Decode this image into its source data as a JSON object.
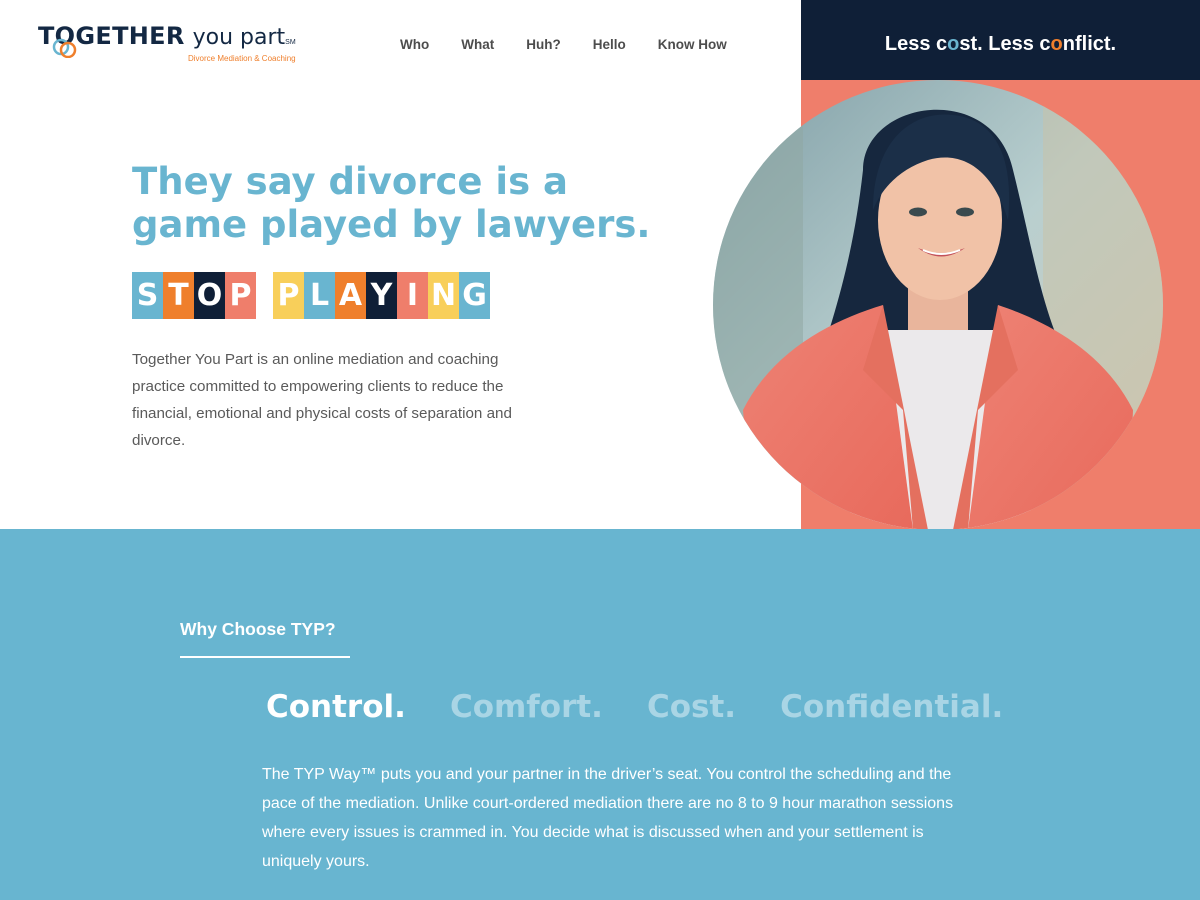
{
  "brand": {
    "name_strong": "TOGETHER",
    "name_light": "you part",
    "trademark": "SM",
    "tagline": "Divorce Mediation & Coaching",
    "colors": {
      "navy": "#132843",
      "orange": "#ef7f2c",
      "blue": "#69b5d0"
    }
  },
  "nav": {
    "items": [
      {
        "label": "Who"
      },
      {
        "label": "What"
      },
      {
        "label": "Huh?"
      },
      {
        "label": "Hello"
      },
      {
        "label": "Know How"
      }
    ]
  },
  "slogan": {
    "part1": "Less c",
    "o1": "o",
    "part2": "st. Less c",
    "o2": "o",
    "part3": "nflict."
  },
  "hero": {
    "headline": "They say divorce is a game played by lawyers.",
    "stop_playing": {
      "tiles": [
        {
          "letter": "S",
          "color": "#69b5d0"
        },
        {
          "letter": "T",
          "color": "#ef7f2c"
        },
        {
          "letter": "O",
          "color": "#0f1f37"
        },
        {
          "letter": "P",
          "color": "#ef7e6b"
        },
        {
          "letter": "",
          "color": "transparent"
        },
        {
          "letter": "P",
          "color": "#f8cf5a"
        },
        {
          "letter": "L",
          "color": "#69b5d0"
        },
        {
          "letter": "A",
          "color": "#ef7f2c"
        },
        {
          "letter": "Y",
          "color": "#0f1f37"
        },
        {
          "letter": "I",
          "color": "#ef7e6b"
        },
        {
          "letter": "N",
          "color": "#f8cf5a"
        },
        {
          "letter": "G",
          "color": "#69b5d0"
        }
      ]
    },
    "intro": "Together You Part is an online mediation and coaching practice committed to empowering clients to reduce the financial, emotional and physical costs of separation and divorce."
  },
  "why": {
    "title": "Why Choose TYP?",
    "tabs": [
      {
        "label": "Control.",
        "active": true
      },
      {
        "label": "Comfort.",
        "active": false
      },
      {
        "label": "Cost.",
        "active": false
      },
      {
        "label": "Confidential.",
        "active": false
      }
    ],
    "body": "The TYP Way™ puts you and your partner in the driver’s seat. You control the scheduling and the pace of the mediation. Unlike court-ordered mediation there are no 8 to 9 hour marathon sessions where every issues is crammed in. You decide what is discussed when and your settlement is uniquely yours."
  },
  "colors": {
    "dark_navy": "#0f1f37",
    "coral": "#ef7e6b",
    "section_blue": "#68b5d0",
    "accent_orange": "#ef7f2c"
  }
}
